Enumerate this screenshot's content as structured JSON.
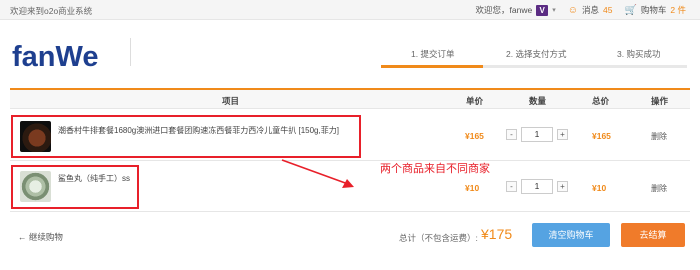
{
  "topbar": {
    "welcome": "欢迎来到o2o商业系统",
    "greeting": "欢迎您，fanwe",
    "vip_badge": "V",
    "messages_label": "消息",
    "messages_count": "45",
    "cart_label": "购物车",
    "cart_count": "2 件"
  },
  "header": {
    "logo_text": "fanWe",
    "steps": [
      "1. 提交订单",
      "2. 选择支付方式",
      "3. 购买成功"
    ],
    "active_step": 1
  },
  "table": {
    "columns": [
      "项目",
      "单价",
      "数量",
      "总价",
      "操作"
    ],
    "rows": [
      {
        "name": "潮香村牛排套餐1680g澳洲进口套餐团购速冻西餐菲力西冷儿童牛扒 [150g,菲力]",
        "price": "¥165",
        "quantity": "1",
        "subtotal": "¥165",
        "action": "删除"
      },
      {
        "name": "鲨鱼丸（纯手工）ss",
        "price": "¥10",
        "quantity": "1",
        "subtotal": "¥10",
        "action": "删除"
      }
    ],
    "minus": "-",
    "plus": "+"
  },
  "annotation": {
    "note": "两个商品来自不同商家",
    "color": "#e8202a"
  },
  "footer": {
    "back_label": "继续购物",
    "total_label": "总计（不包含运费）:",
    "total_value": "¥175",
    "clear_button": "清空购物车",
    "checkout_button": "去结算"
  },
  "colors": {
    "accent": "#f08a1a",
    "primary_button": "#55a3e2",
    "checkout_button": "#f07b2a"
  }
}
